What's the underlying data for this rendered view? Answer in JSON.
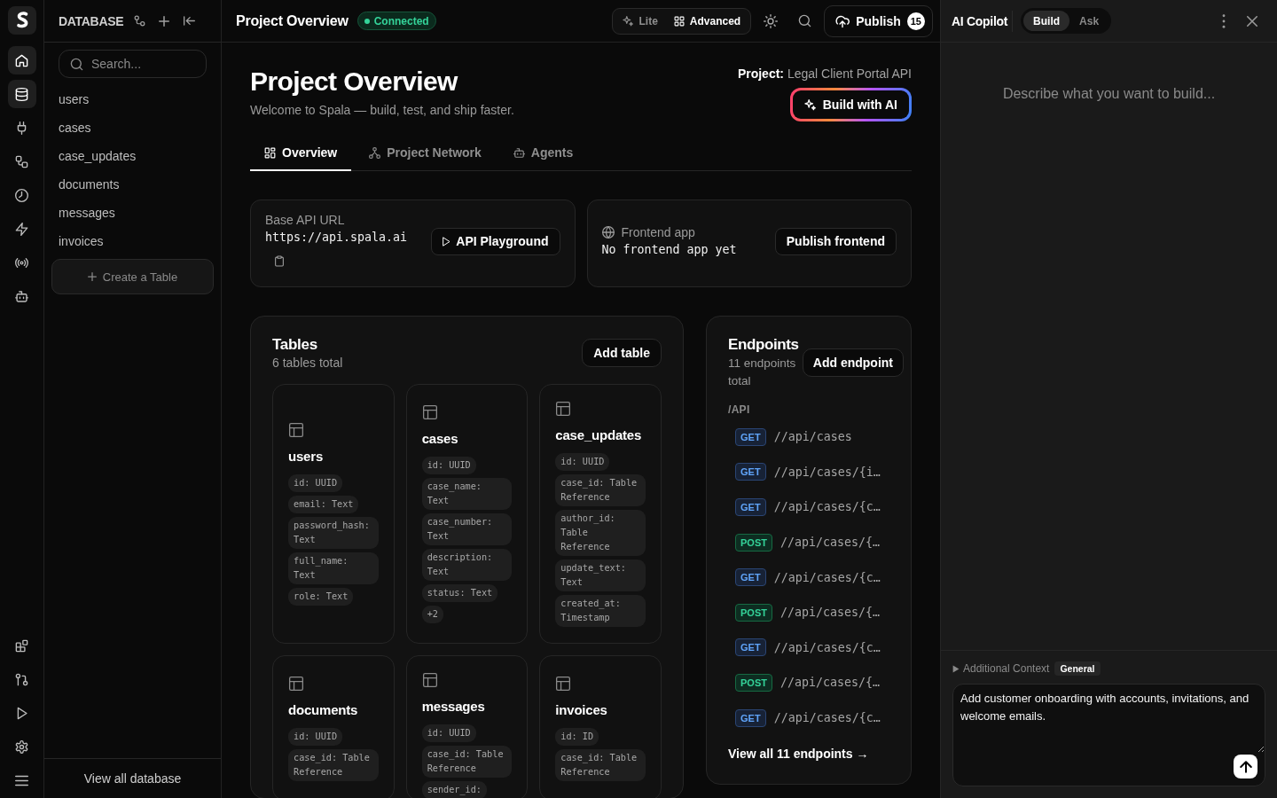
{
  "nav_rail": {
    "items": [
      {
        "selected": true
      },
      {
        "selected": true
      },
      {
        "selected": false
      },
      {
        "selected": false
      },
      {
        "selected": false
      },
      {
        "selected": false
      },
      {
        "selected": false
      },
      {
        "selected": false
      }
    ]
  },
  "database_panel": {
    "title": "DATABASE",
    "search": {
      "placeholder": "Search..."
    },
    "tables": [
      {
        "label": "users",
        "selected": false
      },
      {
        "label": "cases",
        "selected": false
      },
      {
        "label": "case_updates",
        "selected": false
      },
      {
        "label": "documents",
        "selected": false
      },
      {
        "label": "messages",
        "selected": false
      },
      {
        "label": "invoices",
        "selected": false
      }
    ],
    "create_button": "Create a Table",
    "footer_link": "View all database"
  },
  "topbar": {
    "title": "Project Overview",
    "status": "Connected",
    "modes": [
      {
        "label": "Lite",
        "selected": false
      },
      {
        "label": "Advanced",
        "selected": true
      }
    ],
    "publish_button": {
      "label": "Publish",
      "count": "15"
    }
  },
  "overview": {
    "title": "Project Overview",
    "subtitle": "Welcome to Spala — build, test, and ship faster.",
    "project": "**Project:** Legal Client Portal API",
    "build_button": "Build with AI",
    "tabs": [
      {
        "label": "Overview",
        "selected": true
      },
      {
        "label": "Project Network",
        "selected": false
      },
      {
        "label": "Agents",
        "selected": false
      }
    ],
    "base_api": {
      "label": "Base API URL",
      "url": "https://api.spala.ai",
      "button": "API Playground"
    },
    "frontend_app": {
      "label": "Frontend app",
      "value": "No frontend app yet",
      "button": "Publish frontend"
    }
  },
  "tables": {
    "title": "Tables",
    "subtitle": "6 tables total",
    "button": "Add table",
    "items": [
      {
        "name": "users",
        "fields": [
          "id: UUID",
          "email: Text",
          "password_hash: Text",
          "full_name: Text",
          "role: Text"
        ]
      },
      {
        "name": "cases",
        "fields": [
          "id: UUID",
          "case_name: Text",
          "case_number: Text",
          "description: Text",
          "status: Text"
        ],
        "more": "+2"
      },
      {
        "name": "case_updates",
        "fields": [
          "id: UUID",
          "case_id: Table Reference",
          "author_id: Table Reference",
          "update_text: Text",
          "created_at: Timestamp"
        ]
      },
      {
        "name": "documents",
        "fields": [
          "id: UUID",
          "case_id: Table Reference"
        ]
      },
      {
        "name": "messages",
        "fields": [
          "id: UUID",
          "case_id: Table Reference",
          "sender_id:"
        ]
      },
      {
        "name": "invoices",
        "fields": [
          "id: ID",
          "case_id: Table Reference"
        ]
      }
    ]
  },
  "endpoints": {
    "title": "Endpoints",
    "subtitle": "11 endpoints total",
    "button": "Add endpoint",
    "group": "/API",
    "items": [
      {
        "method": "GET",
        "kind": "get",
        "path": "//api/cases"
      },
      {
        "method": "GET",
        "kind": "get",
        "path": "//api/cases/{i…"
      },
      {
        "method": "GET",
        "kind": "get",
        "path": "//api/cases/{c…"
      },
      {
        "method": "POST",
        "kind": "post",
        "path": "//api/cases/{…"
      },
      {
        "method": "GET",
        "kind": "get",
        "path": "//api/cases/{c…"
      },
      {
        "method": "POST",
        "kind": "post",
        "path": "//api/cases/{…"
      },
      {
        "method": "GET",
        "kind": "get",
        "path": "//api/cases/{c…"
      },
      {
        "method": "POST",
        "kind": "post",
        "path": "//api/cases/{…"
      },
      {
        "method": "GET",
        "kind": "get",
        "path": "//api/cases/{c…"
      }
    ],
    "footer_link": "View all 11 endpoints →"
  },
  "copilot": {
    "title": "AI Copilot",
    "modes": [
      {
        "label": "Build",
        "selected": true
      },
      {
        "label": "Ask",
        "selected": false
      }
    ],
    "empty_state": "Describe what you want to build...",
    "context": {
      "label": "Additional Context",
      "tag": "General",
      "expanded": false
    },
    "prompt": {
      "value": "Add customer onboarding with accounts, invitations, and welcome emails."
    }
  }
}
